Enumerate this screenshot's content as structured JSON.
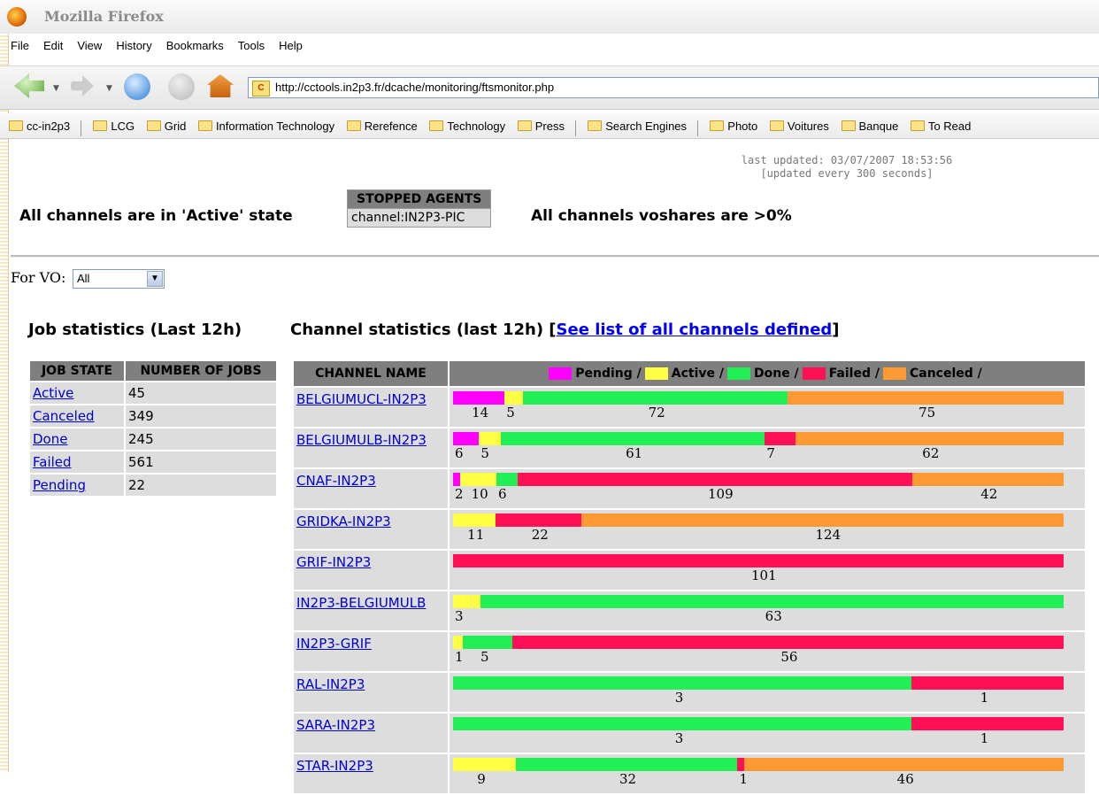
{
  "window": {
    "title": "Mozilla Firefox"
  },
  "menu": [
    "File",
    "Edit",
    "View",
    "History",
    "Bookmarks",
    "Tools",
    "Help"
  ],
  "url": "http://cctools.in2p3.fr/dcache/monitoring/ftsmonitor.php",
  "favicon_text": "C",
  "bookmarks": [
    "cc-in2p3",
    "LCG",
    "Grid",
    "Information Technology",
    "Rerefence",
    "Technology",
    "Press",
    "Search Engines",
    "Photo",
    "Voitures",
    "Banque",
    "To Read"
  ],
  "page": {
    "last_updated": "last updated: 03/07/2007 18:53:56",
    "updated_every": "[updated every 300 seconds]",
    "channels_state": "All channels are in 'Active' state",
    "stopped_agents_header": "STOPPED AGENTS",
    "stopped_agent": "channel:IN2P3-PIC",
    "voshares": "All channels voshares are >0%",
    "for_vo_label": "For VO:",
    "vo_selected": "All",
    "job_stats_title": "Job statistics (Last 12h)",
    "chan_stats_title": "Channel statistics (last 12h) [",
    "chan_stats_link": "See list of all channels defined",
    "chan_stats_close": "]"
  },
  "job_table": {
    "headers": [
      "JOB STATE",
      "NUMBER OF JOBS"
    ],
    "rows": [
      {
        "state": "Active",
        "count": "45"
      },
      {
        "state": "Canceled",
        "count": "349"
      },
      {
        "state": "Done",
        "count": "245"
      },
      {
        "state": "Failed",
        "count": "561"
      },
      {
        "state": "Pending",
        "count": "22"
      }
    ]
  },
  "colors": {
    "Pending": "#ff00ff",
    "Active": "#ffff44",
    "Done": "#22ee55",
    "Failed": "#ff0f55",
    "Canceled": "#ff9933"
  },
  "chart_data": {
    "type": "bar",
    "stacked": true,
    "orientation": "horizontal",
    "category_header": "CHANNEL NAME",
    "series_order": [
      "Pending",
      "Active",
      "Done",
      "Failed",
      "Canceled"
    ],
    "legend_labels": [
      "Pending /",
      "Active /",
      "Done /",
      "Failed /",
      "Canceled /"
    ],
    "rows": [
      {
        "name": "BELGIUMUCL-IN2P3",
        "values": {
          "Pending": 14,
          "Active": 5,
          "Done": 72,
          "Canceled": 75
        }
      },
      {
        "name": "BELGIUMULB-IN2P3",
        "values": {
          "Pending": 6,
          "Active": 5,
          "Done": 61,
          "Failed": 7,
          "Canceled": 62
        }
      },
      {
        "name": "CNAF-IN2P3",
        "values": {
          "Pending": 2,
          "Active": 10,
          "Done": 6,
          "Failed": 109,
          "Canceled": 42
        }
      },
      {
        "name": "GRIDKA-IN2P3",
        "values": {
          "Active": 11,
          "Failed": 22,
          "Canceled": 124
        }
      },
      {
        "name": "GRIF-IN2P3",
        "values": {
          "Failed": 101
        }
      },
      {
        "name": "IN2P3-BELGIUMULB",
        "values": {
          "Active": 3,
          "Done": 63
        }
      },
      {
        "name": "IN2P3-GRIF",
        "values": {
          "Active": 1,
          "Done": 5,
          "Failed": 56
        }
      },
      {
        "name": "RAL-IN2P3",
        "values": {
          "Done": 3,
          "Failed": 1
        }
      },
      {
        "name": "SARA-IN2P3",
        "values": {
          "Done": 3,
          "Failed": 1
        }
      },
      {
        "name": "STAR-IN2P3",
        "values": {
          "Active": 9,
          "Done": 32,
          "Failed": 1,
          "Canceled": 46
        }
      }
    ]
  }
}
